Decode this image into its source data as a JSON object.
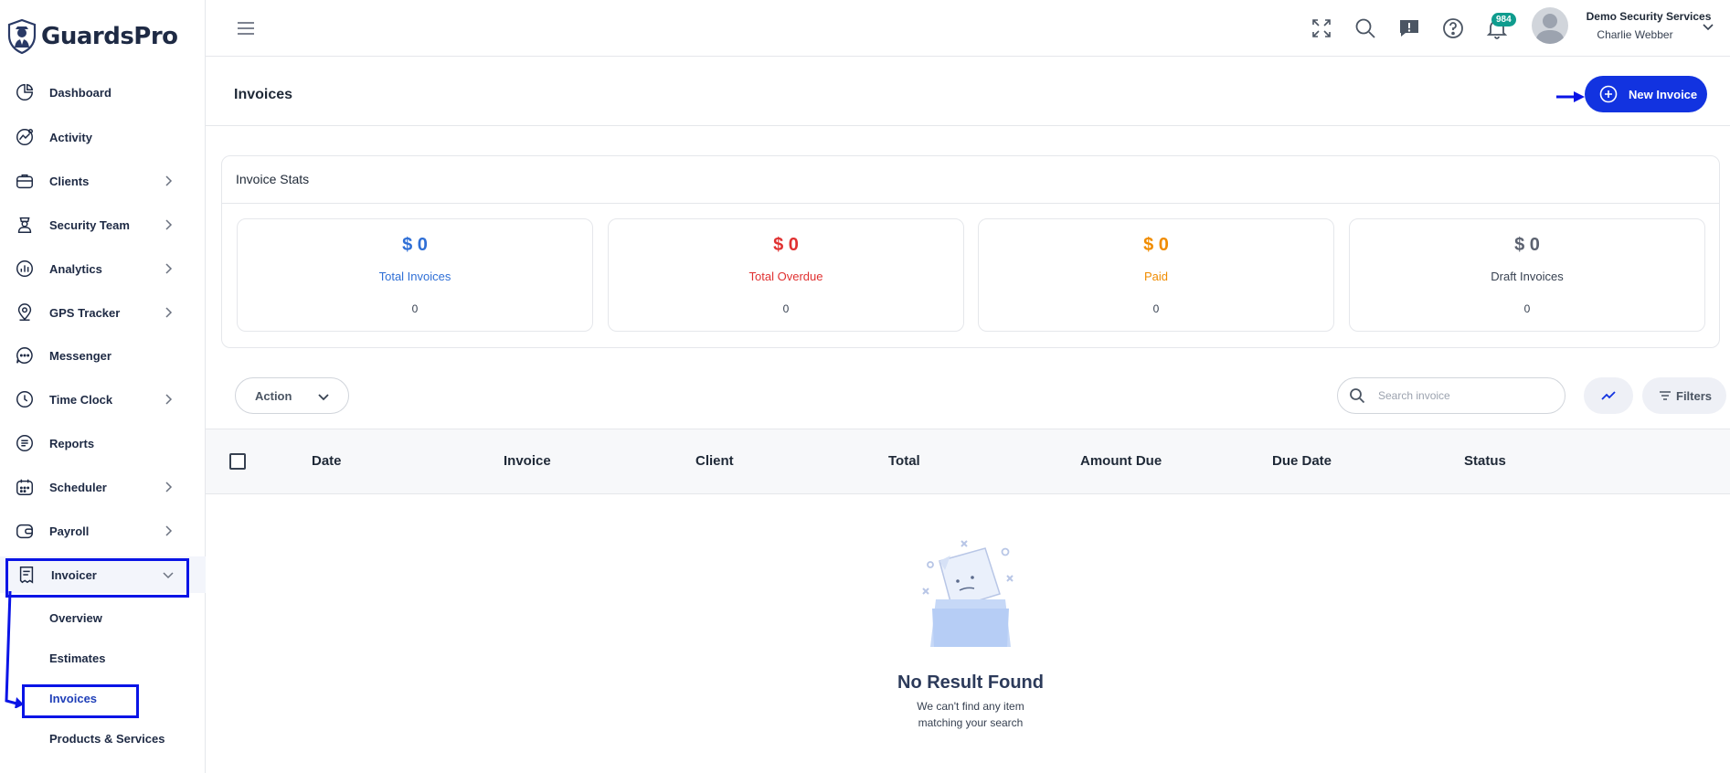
{
  "app": {
    "name": "GuardsPro"
  },
  "sidebar": {
    "items": [
      {
        "label": "Dashboard",
        "icon": "dashboard-icon",
        "has_children": false
      },
      {
        "label": "Activity",
        "icon": "activity-icon",
        "has_children": false
      },
      {
        "label": "Clients",
        "icon": "briefcase-icon",
        "has_children": true
      },
      {
        "label": "Security Team",
        "icon": "guard-icon",
        "has_children": true
      },
      {
        "label": "Analytics",
        "icon": "analytics-icon",
        "has_children": true
      },
      {
        "label": "GPS Tracker",
        "icon": "map-pin-icon",
        "has_children": true
      },
      {
        "label": "Messenger",
        "icon": "chat-icon",
        "has_children": false
      },
      {
        "label": "Time Clock",
        "icon": "clock-icon",
        "has_children": true
      },
      {
        "label": "Reports",
        "icon": "report-icon",
        "has_children": false
      },
      {
        "label": "Scheduler",
        "icon": "calendar-icon",
        "has_children": true
      },
      {
        "label": "Payroll",
        "icon": "wallet-icon",
        "has_children": true
      },
      {
        "label": "Invoicer",
        "icon": "invoice-icon",
        "has_children": true,
        "expanded": true
      }
    ],
    "invoicer_sub": [
      {
        "label": "Overview"
      },
      {
        "label": "Estimates"
      },
      {
        "label": "Invoices",
        "active": true
      },
      {
        "label": "Products & Services"
      }
    ]
  },
  "header": {
    "notifications_count": "984",
    "company": "Demo Security Services",
    "user_name": "Charlie Webber"
  },
  "page": {
    "title": "Invoices",
    "new_button_label": "New Invoice"
  },
  "stats": {
    "heading": "Invoice Stats",
    "cards": [
      {
        "amount": "$ 0",
        "label": "Total Invoices",
        "count": "0",
        "color": "#2f6fd6"
      },
      {
        "amount": "$ 0",
        "label": "Total Overdue",
        "count": "0",
        "color": "#e03131"
      },
      {
        "amount": "$ 0",
        "label": "Paid",
        "count": "0",
        "color": "#f08c00"
      },
      {
        "amount": "$ 0",
        "label": "Draft Invoices",
        "count": "0",
        "color": "#5c6270"
      }
    ]
  },
  "toolbar": {
    "action_label": "Action",
    "search_placeholder": "Search invoice",
    "filters_label": "Filters"
  },
  "table": {
    "columns": [
      "Date",
      "Invoice",
      "Client",
      "Total",
      "Amount Due",
      "Due Date",
      "Status"
    ]
  },
  "empty_state": {
    "title": "No Result Found",
    "line1": "We can't find any item",
    "line2": "matching your search"
  },
  "colors": {
    "primary": "#1233e0",
    "annotation": "#0a14e6",
    "text_dark": "#1e2a44"
  }
}
